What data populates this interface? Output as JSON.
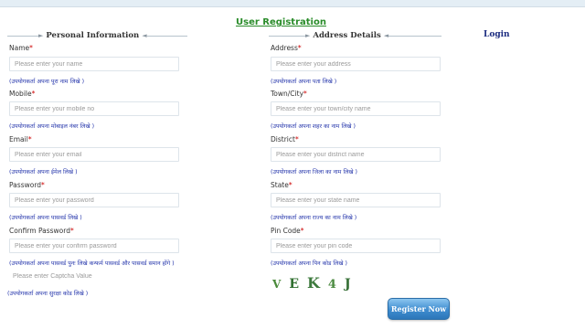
{
  "page_title": "User Registration",
  "login_link": "Login",
  "sections": {
    "personal": "Personal Information",
    "address": "Address Details"
  },
  "personal_fields": [
    {
      "label": "Name",
      "required": "*",
      "placeholder": "Please enter your name",
      "hint": "(उपयोगकर्ता अपना पूरा नाम लिखे )"
    },
    {
      "label": "Mobile",
      "required": "*",
      "placeholder": "Please enter your mobile no",
      "hint": "(उपयोगकर्ता अपना मोबाइल नंबर लिखे )"
    },
    {
      "label": "Email",
      "required": "*",
      "placeholder": "Please enter your email",
      "hint": "(उपयोगकर्ता अपना ईमेल लिखे )"
    },
    {
      "label": "Password",
      "required": "*",
      "placeholder": "Please enter your password",
      "hint": "(उपयोगकर्ता अपना पासवर्ड लिखे )"
    },
    {
      "label": "Confirm Password",
      "required": "*",
      "placeholder": "Please enter your confirm password",
      "hint": "(उपयोगकर्ता अपना पासवर्ड पुनः लिखे कन्फर्म पासवर्ड और पासवर्ड समान होंगे )"
    }
  ],
  "captcha_field": {
    "placeholder": "Please enter Captcha Value",
    "hint": "(उपयोगकर्ता अपना सुरक्षा कोड लिखे )"
  },
  "address_fields": [
    {
      "label": "Address",
      "required": "*",
      "placeholder": "Please enter your address",
      "hint": "(उपयोगकर्ता अपना पता लिखे )"
    },
    {
      "label": "Town/City",
      "required": "*",
      "placeholder": "Please enter your town/city name",
      "hint": "(उपयोगकर्ता अपना शहर का नाम लिखे )"
    },
    {
      "label": "District",
      "required": "*",
      "placeholder": "Please enter your district name",
      "hint": "(उपयोगकर्ता अपना जिला का नाम लिखे )"
    },
    {
      "label": "State",
      "required": "*",
      "placeholder": "Please enter your state name",
      "hint": "(उपयोगकर्ता अपना राज्य का नाम लिखे )"
    },
    {
      "label": "Pin Code",
      "required": "*",
      "placeholder": "Please enter your pin code",
      "hint": "(उपयोगकर्ता अपना पिन कोड लिखे )"
    }
  ],
  "captcha": [
    "V",
    "E",
    "K",
    "4",
    "J"
  ],
  "register_button": "Register Now",
  "colors": {
    "title": "#2a8c2a",
    "hint": "#2233aa",
    "button": "#3e8ccf",
    "login": "#1c2c80",
    "captcha": "#3a7d3a"
  }
}
